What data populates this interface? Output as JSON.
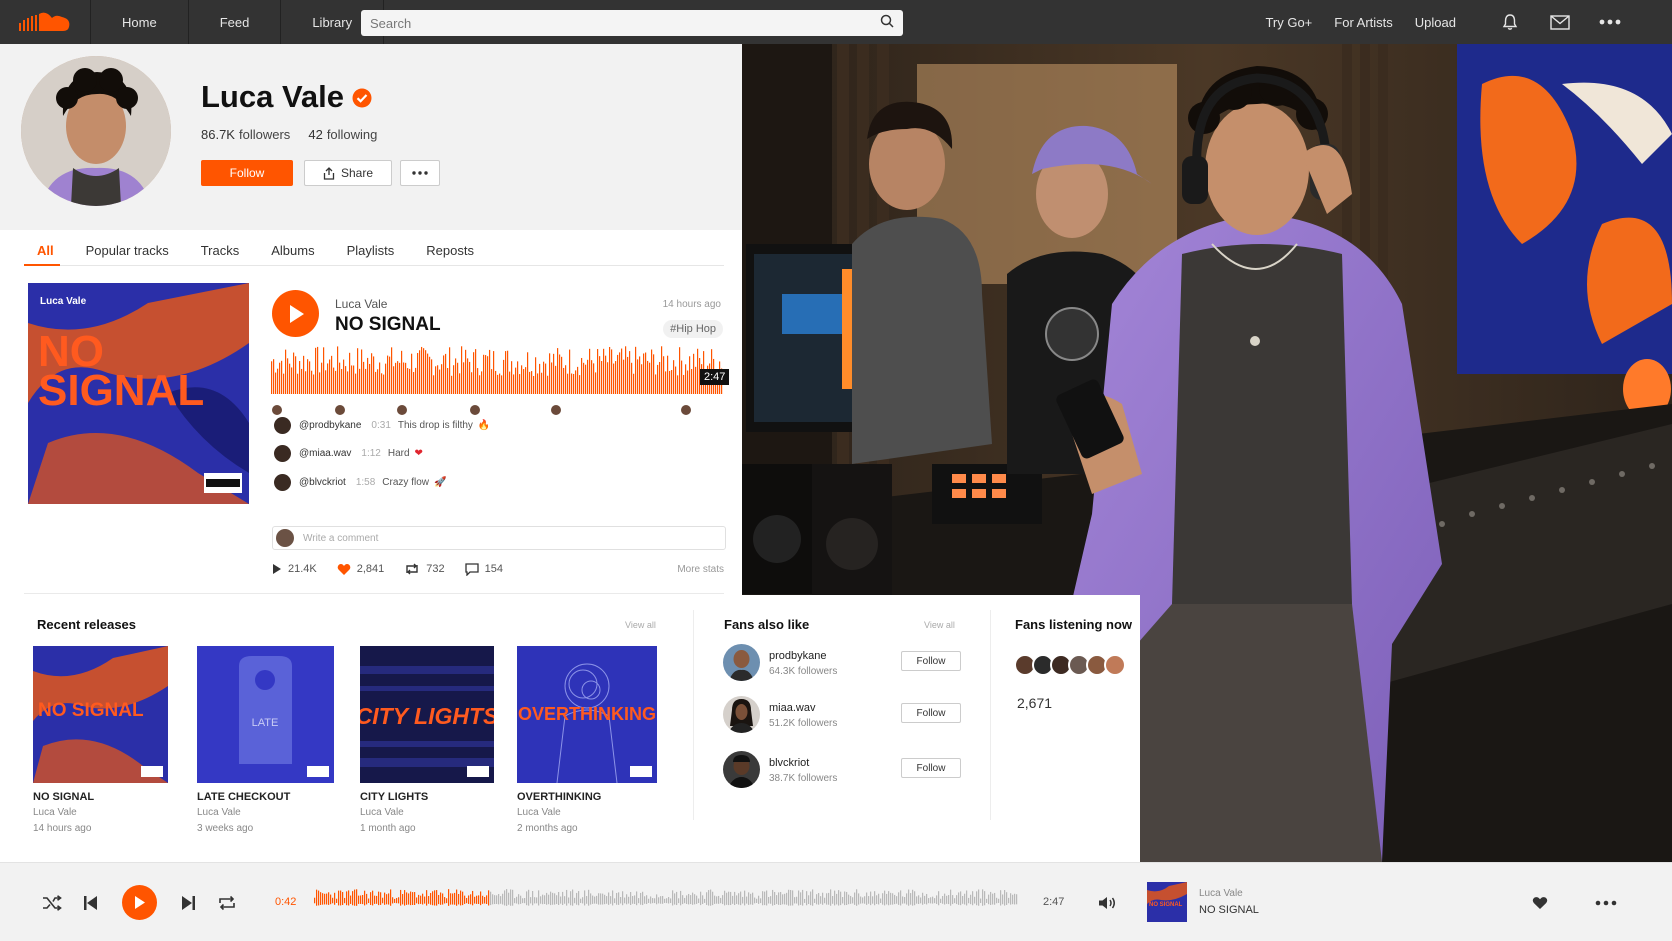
{
  "nav": {
    "links": [
      "Home",
      "Feed",
      "Library"
    ],
    "search_placeholder": "Search",
    "right_links": [
      "Try Go+",
      "For Artists",
      "Upload"
    ]
  },
  "profile": {
    "name": "Luca Vale",
    "followers_count": "86.7K",
    "followers_label": "followers",
    "following_count": "42",
    "following_label": "following",
    "follow_label": "Follow",
    "share_label": "Share"
  },
  "tabs": [
    "All",
    "Popular tracks",
    "Tracks",
    "Albums",
    "Playlists",
    "Reposts"
  ],
  "featured": {
    "cover_artist": "Luca Vale",
    "cover_title_line1": "NO",
    "cover_title_line2": "SIGNAL",
    "artist": "Luca Vale",
    "title": "NO SIGNAL",
    "time_ago": "14 hours ago",
    "tag": "#Hip Hop",
    "duration": "2:47",
    "comments": [
      {
        "user": "@prodbykane",
        "time": "0:31",
        "text": "This drop is filthy",
        "emoji": "🔥"
      },
      {
        "user": "@miaa.wav",
        "time": "1:12",
        "text": "Hard",
        "emoji": "❤"
      },
      {
        "user": "@blvckriot",
        "time": "1:58",
        "text": "Crazy flow",
        "emoji": "🚀"
      }
    ],
    "comment_placeholder": "Write a comment",
    "plays": "21.4K",
    "likes": "2,841",
    "reposts": "732",
    "comment_count": "154",
    "more_stats": "More stats"
  },
  "recent": {
    "title": "Recent releases",
    "view_all": "View all",
    "items": [
      {
        "title": "NO SIGNAL",
        "artist": "Luca Vale",
        "date": "14 hours ago",
        "cover_text": "NO SIGNAL"
      },
      {
        "title": "LATE CHECKOUT",
        "artist": "Luca Vale",
        "date": "3 weeks ago",
        "cover_text": "LATE"
      },
      {
        "title": "CITY LIGHTS",
        "artist": "Luca Vale",
        "date": "1 month ago",
        "cover_text": "CITY LIGHTS"
      },
      {
        "title": "OVERTHINKING",
        "artist": "Luca Vale",
        "date": "2 months ago",
        "cover_text": "OVERTHINKING"
      }
    ]
  },
  "fans": {
    "title": "Fans also like",
    "view_all": "View all",
    "items": [
      {
        "name": "prodbykane",
        "followers": "64.3K followers",
        "follow": "Follow"
      },
      {
        "name": "miaa.wav",
        "followers": "51.2K followers",
        "follow": "Follow"
      },
      {
        "name": "blvckriot",
        "followers": "38.7K followers",
        "follow": "Follow"
      }
    ]
  },
  "listening": {
    "title": "Fans listening now",
    "count": "2,671"
  },
  "player": {
    "current_time": "0:42",
    "total_time": "2:47",
    "artist": "Luca Vale",
    "title": "NO SIGNAL",
    "cover_text": "NO SIGNAL",
    "progress": 0.25
  },
  "colors": {
    "accent": "#ff5500",
    "nav_bg": "#333333",
    "cover_blue": "#2b2fa8"
  }
}
